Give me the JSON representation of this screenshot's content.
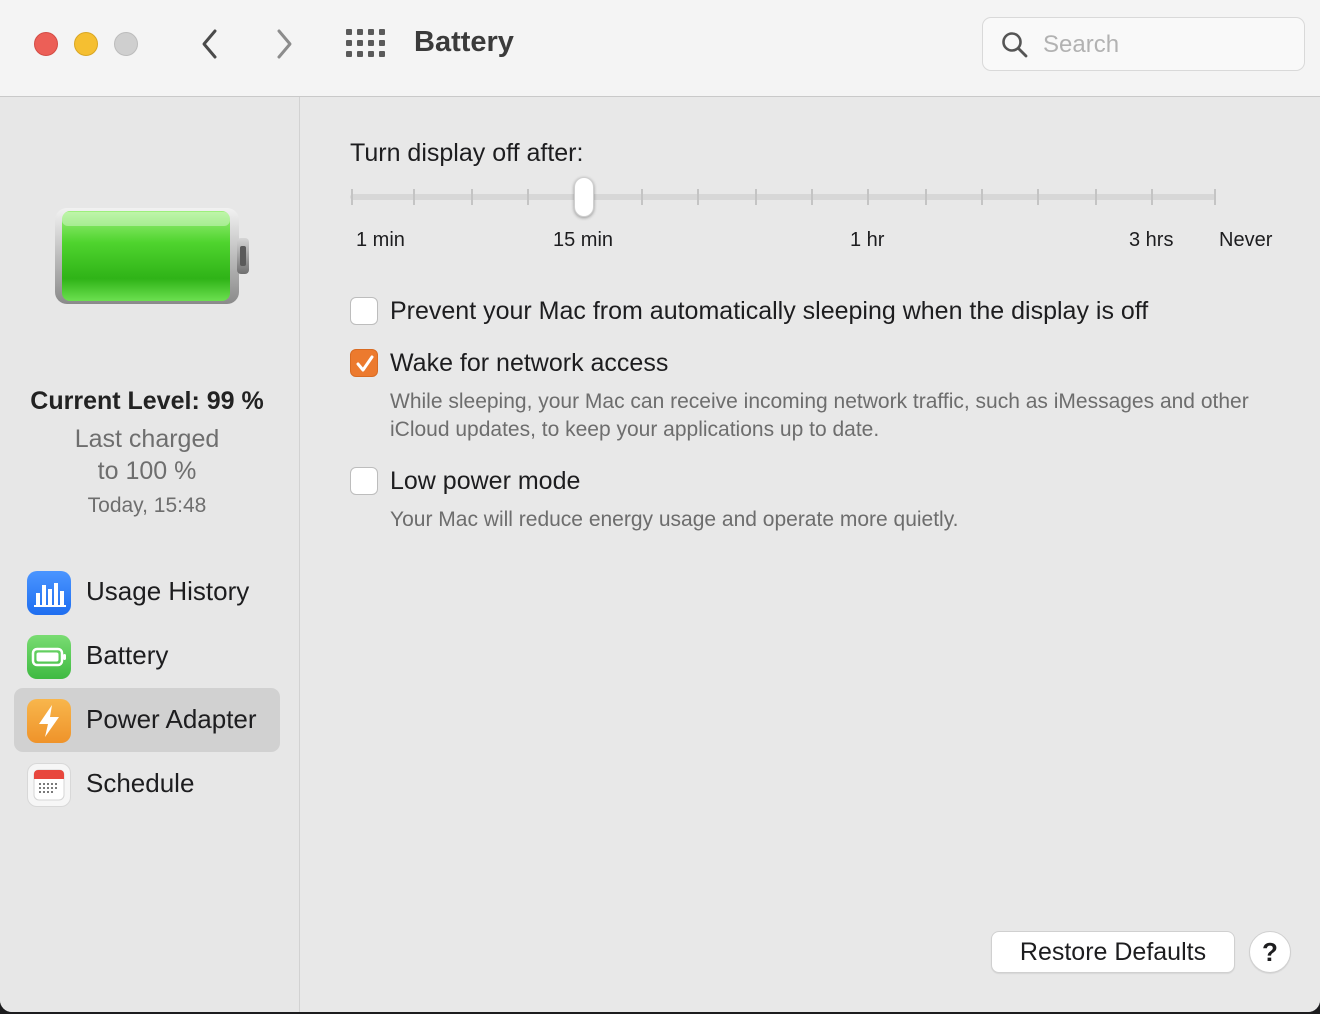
{
  "window": {
    "title": "Battery",
    "search_placeholder": "Search",
    "traffic_lights": [
      "close",
      "minimize",
      "zoom-disabled"
    ],
    "icons": {
      "back": "chevron-left-icon",
      "forward": "chevron-right-icon",
      "grid": "grid-icon",
      "search": "magnifier-icon"
    }
  },
  "sidebar": {
    "current_level": "Current Level: 99 %",
    "last_charged_line1": "Last charged",
    "last_charged_line2": "to 100 %",
    "last_charged_time": "Today, 15:48",
    "battery_level_fraction": 0.99,
    "items": [
      {
        "label": "Usage History",
        "icon": "bar-chart-icon",
        "color": "#2f7cf6",
        "selected": false
      },
      {
        "label": "Battery",
        "icon": "battery-icon",
        "color": "#4cc552",
        "selected": false
      },
      {
        "label": "Power Adapter",
        "icon": "lightning-icon",
        "color": "#f3a33a",
        "selected": true
      },
      {
        "label": "Schedule",
        "icon": "calendar-icon",
        "color": "#e8473d",
        "selected": false
      }
    ]
  },
  "main": {
    "slider_title": "Turn display off after:",
    "slider_labels": [
      "1 min",
      "15 min",
      "1 hr",
      "3 hrs",
      "Never"
    ],
    "slider_value": "15 min",
    "options": [
      {
        "label": "Prevent your Mac from automatically sleeping when the display is off",
        "checked": false,
        "description": ""
      },
      {
        "label": "Wake for network access",
        "checked": true,
        "description": "While sleeping, your Mac can receive incoming network traffic, such as iMessages and other iCloud updates, to keep your applications up to date."
      },
      {
        "label": "Low power mode",
        "checked": false,
        "description": "Your Mac will reduce energy usage and operate more quietly."
      }
    ],
    "restore_label": "Restore Defaults",
    "help_label": "?"
  },
  "colors": {
    "accent_checkbox": "#ec7a2e",
    "battery_fill": "#4cd137",
    "selected_row": "#d1d1d1"
  }
}
